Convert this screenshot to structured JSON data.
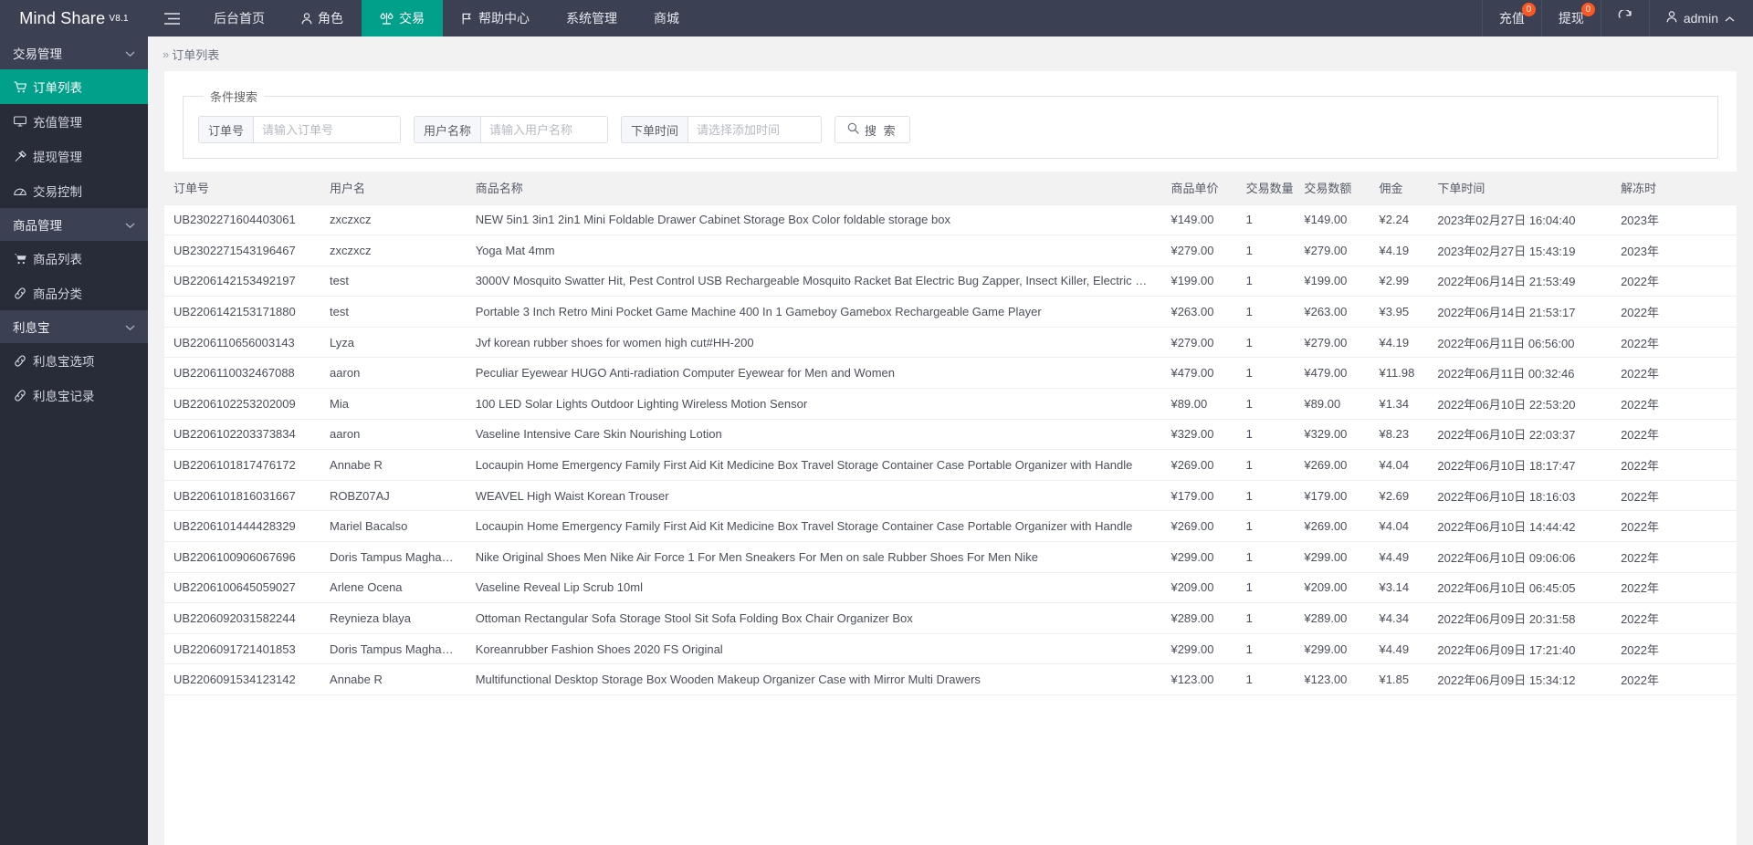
{
  "header": {
    "brand": "Mind Share",
    "version": "V8.1",
    "menu_icon": "hamburger-icon",
    "nav": [
      {
        "label": "后台首页",
        "icon": "",
        "active": false
      },
      {
        "label": "角色",
        "icon": "user-icon",
        "active": false
      },
      {
        "label": "交易",
        "icon": "scale-icon",
        "active": true
      },
      {
        "label": "帮助中心",
        "icon": "flag-icon",
        "active": false
      },
      {
        "label": "系统管理",
        "icon": "",
        "active": false
      },
      {
        "label": "商城",
        "icon": "",
        "active": false
      }
    ],
    "tools": {
      "recharge_label": "充值",
      "recharge_badge": "0",
      "withdraw_label": "提现",
      "withdraw_badge": "0",
      "refresh_icon": "refresh-icon",
      "user_icon": "user-icon",
      "user_name": "admin",
      "user_chevron": "chevron-up-icon"
    }
  },
  "sidebar": {
    "groups": [
      {
        "label": "交易管理",
        "chevron": "chevron-down-icon",
        "items": [
          {
            "label": "订单列表",
            "icon": "cart-icon",
            "active": true
          },
          {
            "label": "充值管理",
            "icon": "monitor-icon",
            "active": false
          },
          {
            "label": "提现管理",
            "icon": "hammer-icon",
            "active": false
          },
          {
            "label": "交易控制",
            "icon": "gauge-icon",
            "active": false
          }
        ]
      },
      {
        "label": "商品管理",
        "chevron": "chevron-down-icon",
        "items": [
          {
            "label": "商品列表",
            "icon": "cart-solid-icon",
            "active": false
          },
          {
            "label": "商品分类",
            "icon": "link-icon",
            "active": false
          }
        ]
      },
      {
        "label": "利息宝",
        "chevron": "chevron-down-icon",
        "items": [
          {
            "label": "利息宝选项",
            "icon": "link-icon",
            "active": false
          },
          {
            "label": "利息宝记录",
            "icon": "link-icon",
            "active": false
          }
        ]
      }
    ]
  },
  "breadcrumb": {
    "arrows": "»",
    "current": "订单列表"
  },
  "search": {
    "legend": "条件搜索",
    "fields": [
      {
        "label": "订单号",
        "placeholder": "请输入订单号",
        "value": ""
      },
      {
        "label": "用户名称",
        "placeholder": "请输入用户名称",
        "value": ""
      },
      {
        "label": "下单时间",
        "placeholder": "请选择添加时间",
        "value": ""
      }
    ],
    "button": {
      "label": "搜 索",
      "icon": "search-icon"
    }
  },
  "table": {
    "columns": [
      "订单号",
      "用户名",
      "商品名称",
      "商品单价",
      "交易数量",
      "交易数额",
      "佣金",
      "下单时间",
      "解冻时"
    ],
    "rows": [
      {
        "order": "UB2302271604403061",
        "user": "zxczxcz",
        "product": "NEW 5in1 3in1 2in1 Mini Foldable Drawer Cabinet Storage Box Color foldable storage box",
        "price": "¥149.00",
        "qty": "1",
        "amount": "¥149.00",
        "commission": "¥2.24",
        "time": "2023年02月27日 16:04:40",
        "thaw": "2023年"
      },
      {
        "order": "UB2302271543196467",
        "user": "zxczxcz",
        "product": "Yoga Mat 4mm",
        "price": "¥279.00",
        "qty": "1",
        "amount": "¥279.00",
        "commission": "¥4.19",
        "time": "2023年02月27日 15:43:19",
        "thaw": "2023年"
      },
      {
        "order": "UB2206142153492197",
        "user": "test",
        "product": "3000V Mosquito Swatter Hit, Pest Control USB Rechargeable Mosquito Racket Bat Electric Bug Zapper, Insect Killer, Electric Mosquito Killer",
        "price": "¥199.00",
        "qty": "1",
        "amount": "¥199.00",
        "commission": "¥2.99",
        "time": "2022年06月14日 21:53:49",
        "thaw": "2022年"
      },
      {
        "order": "UB2206142153171880",
        "user": "test",
        "product": "Portable 3 Inch Retro Mini Pocket Game Machine 400 In 1 Gameboy Gamebox Rechargeable Game Player",
        "price": "¥263.00",
        "qty": "1",
        "amount": "¥263.00",
        "commission": "¥3.95",
        "time": "2022年06月14日 21:53:17",
        "thaw": "2022年"
      },
      {
        "order": "UB2206110656003143",
        "user": "Lyza",
        "product": "Jvf korean rubber shoes for women high cut#HH-200",
        "price": "¥279.00",
        "qty": "1",
        "amount": "¥279.00",
        "commission": "¥4.19",
        "time": "2022年06月11日 06:56:00",
        "thaw": "2022年"
      },
      {
        "order": "UB2206110032467088",
        "user": "aaron",
        "product": "Peculiar Eyewear HUGO Anti-radiation Computer Eyewear for Men and Women",
        "price": "¥479.00",
        "qty": "1",
        "amount": "¥479.00",
        "commission": "¥11.98",
        "time": "2022年06月11日 00:32:46",
        "thaw": "2022年"
      },
      {
        "order": "UB2206102253202009",
        "user": "Mia",
        "product": "100 LED Solar Lights Outdoor Lighting Wireless Motion Sensor",
        "price": "¥89.00",
        "qty": "1",
        "amount": "¥89.00",
        "commission": "¥1.34",
        "time": "2022年06月10日 22:53:20",
        "thaw": "2022年"
      },
      {
        "order": "UB2206102203373834",
        "user": "aaron",
        "product": "Vaseline Intensive Care Skin Nourishing Lotion",
        "price": "¥329.00",
        "qty": "1",
        "amount": "¥329.00",
        "commission": "¥8.23",
        "time": "2022年06月10日 22:03:37",
        "thaw": "2022年"
      },
      {
        "order": "UB2206101817476172",
        "user": "Annabe R",
        "product": "Locaupin Home Emergency Family First Aid Kit Medicine Box Travel Storage Container Case Portable Organizer with Handle",
        "price": "¥269.00",
        "qty": "1",
        "amount": "¥269.00",
        "commission": "¥4.04",
        "time": "2022年06月10日 18:17:47",
        "thaw": "2022年"
      },
      {
        "order": "UB2206101816031667",
        "user": "ROBZ07AJ",
        "product": "WEAVEL High Waist Korean Trouser",
        "price": "¥179.00",
        "qty": "1",
        "amount": "¥179.00",
        "commission": "¥2.69",
        "time": "2022年06月10日 18:16:03",
        "thaw": "2022年"
      },
      {
        "order": "UB2206101444428329",
        "user": "Mariel Bacalso",
        "product": "Locaupin Home Emergency Family First Aid Kit Medicine Box Travel Storage Container Case Portable Organizer with Handle",
        "price": "¥269.00",
        "qty": "1",
        "amount": "¥269.00",
        "commission": "¥4.04",
        "time": "2022年06月10日 14:44:42",
        "thaw": "2022年"
      },
      {
        "order": "UB2206100906067696",
        "user": "Doris Tampus Maghanoy",
        "product": "Nike Original Shoes Men Nike Air Force 1 For Men Sneakers For Men on sale Rubber Shoes For Men Nike",
        "price": "¥299.00",
        "qty": "1",
        "amount": "¥299.00",
        "commission": "¥4.49",
        "time": "2022年06月10日 09:06:06",
        "thaw": "2022年"
      },
      {
        "order": "UB2206100645059027",
        "user": "Arlene Ocena",
        "product": "Vaseline Reveal Lip Scrub 10ml",
        "price": "¥209.00",
        "qty": "1",
        "amount": "¥209.00",
        "commission": "¥3.14",
        "time": "2022年06月10日 06:45:05",
        "thaw": "2022年"
      },
      {
        "order": "UB2206092031582244",
        "user": "Reynieza blaya",
        "product": "Ottoman Rectangular Sofa Storage Stool Sit Sofa Folding Box Chair Organizer Box",
        "price": "¥289.00",
        "qty": "1",
        "amount": "¥289.00",
        "commission": "¥4.34",
        "time": "2022年06月09日 20:31:58",
        "thaw": "2022年"
      },
      {
        "order": "UB2206091721401853",
        "user": "Doris Tampus Maghanoy",
        "product": "Koreanrubber Fashion Shoes 2020 FS Original",
        "price": "¥299.00",
        "qty": "1",
        "amount": "¥299.00",
        "commission": "¥4.49",
        "time": "2022年06月09日 17:21:40",
        "thaw": "2022年"
      },
      {
        "order": "UB2206091534123142",
        "user": "Annabe R",
        "product": "Multifunctional Desktop Storage Box Wooden Makeup Organizer Case with Mirror Multi Drawers",
        "price": "¥123.00",
        "qty": "1",
        "amount": "¥123.00",
        "commission": "¥1.85",
        "time": "2022年06月09日 15:34:12",
        "thaw": "2022年"
      }
    ]
  },
  "colors": {
    "accent": "#00a08a",
    "header_bg": "#3b4052",
    "sidebar_bg": "#282b38",
    "badge": "#ff5722"
  }
}
